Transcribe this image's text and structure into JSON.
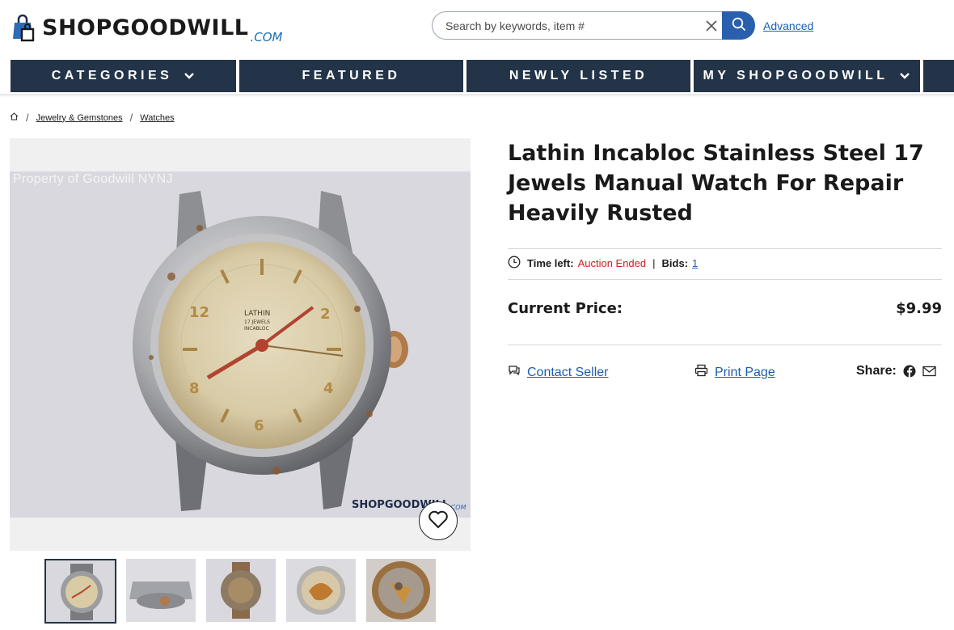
{
  "header": {
    "logo_text": "SHOPGOODWILL",
    "logo_suffix": ".COM",
    "search_placeholder": "Search by keywords, item #",
    "advanced_label": "Advanced"
  },
  "nav": {
    "items": [
      {
        "label": "CATEGORIES",
        "has_chevron": true
      },
      {
        "label": "FEATURED",
        "has_chevron": false
      },
      {
        "label": "NEWLY LISTED",
        "has_chevron": false
      },
      {
        "label": "MY SHOPGOODWILL",
        "has_chevron": true
      }
    ],
    "color": "#243448"
  },
  "breadcrumb": {
    "home_icon": "home-icon",
    "items": [
      "Jewelry & Gemstones",
      "Watches"
    ]
  },
  "gallery": {
    "watermark": "Property of Goodwill NYNJ",
    "photo_logo_text": "SHOPGOODWILL",
    "photo_logo_suffix": ".COM",
    "thumbnail_count": 5,
    "active_thumbnail": 1
  },
  "item": {
    "title": "Lathin Incabloc Stainless Steel 17 Jewels Manual Watch For Repair Heavily Rusted",
    "time_left_label": "Time left:",
    "time_left_value": "Auction Ended",
    "bids_label": "Bids:",
    "bids_value": "1",
    "current_price_label": "Current Price:",
    "current_price_value": "$9.99"
  },
  "actions": {
    "contact_seller": "Contact Seller",
    "print_page": "Print Page",
    "share_label": "Share:"
  },
  "colors": {
    "nav_bg": "#243448",
    "link": "#1b5fb0",
    "ended": "#cc2121",
    "search_button": "#2a5fae"
  }
}
